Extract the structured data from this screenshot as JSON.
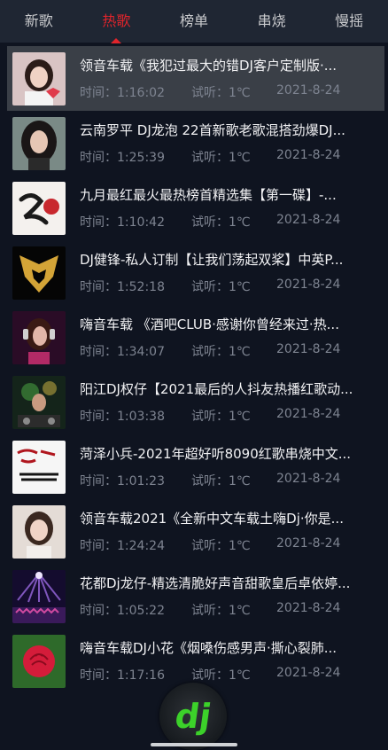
{
  "tabs": [
    {
      "label": "新歌",
      "active": false
    },
    {
      "label": "热歌",
      "active": true
    },
    {
      "label": "榜单",
      "active": false
    },
    {
      "label": "串烧",
      "active": false
    },
    {
      "label": "慢摇",
      "active": false
    }
  ],
  "labels": {
    "time": "时间：",
    "listen": "试听："
  },
  "songs": [
    {
      "title": "领音车载《我犯过最大的错DJ客户定制版·...",
      "duration": "1:16:02",
      "listens": "1℃",
      "date": "2021-8-24",
      "thumb_icon": "girl-hello-photo"
    },
    {
      "title": "云南罗平 DJ龙泡 22首新歌老歌混搭劲爆DJ...",
      "duration": "1:25:39",
      "listens": "1℃",
      "date": "2021-8-24",
      "thumb_icon": "dark-hair-girl-photo"
    },
    {
      "title": "九月最红最火最热榜首精选集【第一碟】-...",
      "duration": "1:10:42",
      "listens": "1℃",
      "date": "2021-8-24",
      "thumb_icon": "art-calligraphy-logo"
    },
    {
      "title": "DJ健锋-私人订制【让我们荡起双桨】中英P...",
      "duration": "1:52:18",
      "listens": "1℃",
      "date": "2021-8-24",
      "thumb_icon": "gold-emblem-logo"
    },
    {
      "title": "嗨音车载 《酒吧CLUB·感谢你曾经来过·热...",
      "duration": "1:34:07",
      "listens": "1℃",
      "date": "2021-8-24",
      "thumb_icon": "headphone-girl-photo"
    },
    {
      "title": "阳江DJ权仔【2021最后的人抖友热播红歌动...",
      "duration": "1:03:38",
      "listens": "1℃",
      "date": "2021-8-24",
      "thumb_icon": "dj-mixer-photo"
    },
    {
      "title": "菏泽小兵-2021年超好听8090红歌串烧中文...",
      "duration": "1:01:23",
      "listens": "1℃",
      "date": "2021-8-24",
      "thumb_icon": "dj-xiaobing-logo"
    },
    {
      "title": "领音车载2021《全新中文车载土嗨Dj·你是...",
      "duration": "1:24:24",
      "listens": "1℃",
      "date": "2021-8-24",
      "thumb_icon": "smiling-girl-photo"
    },
    {
      "title": "花都Dj龙仔-精选清脆好声音甜歌皇后卓依婷...",
      "duration": "1:05:22",
      "listens": "1℃",
      "date": "2021-8-24",
      "thumb_icon": "concert-lights-photo"
    },
    {
      "title": "嗨音车载DJ小花《烟嗓伤感男声·撕心裂肺...",
      "duration": "1:17:16",
      "listens": "1℃",
      "date": "2021-8-24",
      "thumb_icon": "red-rose-photo"
    }
  ],
  "fab": {
    "label": "dj"
  },
  "colors": {
    "accent": "#e0242b",
    "tabbar": "#1f2633",
    "background": "#0f1420",
    "dj_green": "#3cd12a"
  }
}
